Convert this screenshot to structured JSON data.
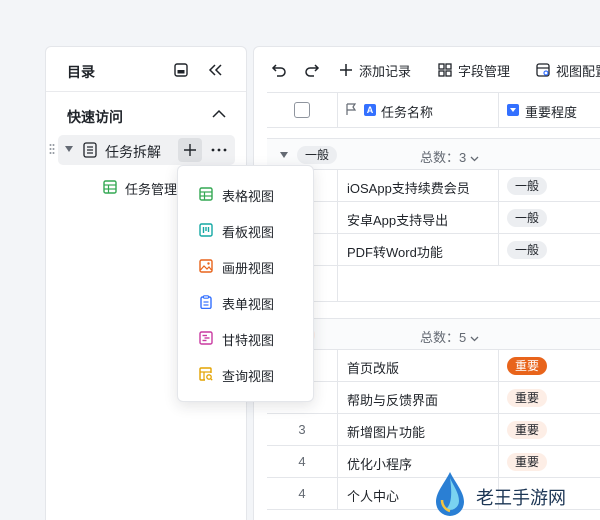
{
  "sidebar": {
    "title": "目录",
    "quick_access": "快速访问",
    "tree_item": "任务拆解",
    "sub_item": "任务管理"
  },
  "toolbar": {
    "add_record": "添加记录",
    "field_manage": "字段管理",
    "view_config": "视图配置"
  },
  "table": {
    "headers": {
      "task_name": "任务名称",
      "importance": "重要程度"
    },
    "groups": [
      {
        "tag": "一般",
        "count": "总数：3",
        "rows": [
          {
            "num": "",
            "name": "iOSApp支持续费会员",
            "level": "一般"
          },
          {
            "num": "",
            "name": "安卓App支持导出",
            "level": "一般"
          },
          {
            "num": "",
            "name": "PDF转Word功能",
            "level": "一般"
          }
        ]
      },
      {
        "tag": "重要",
        "count": "总数：5",
        "rows": [
          {
            "num": "",
            "name": "首页改版",
            "level": "重要"
          },
          {
            "num": "2",
            "name": "帮助与反馈界面",
            "level": "重要"
          },
          {
            "num": "3",
            "name": "新增图片功能",
            "level": "重要"
          },
          {
            "num": "4",
            "name": "优化小程序",
            "level": "重要"
          },
          {
            "num": "4",
            "name": "个人中心",
            "level": ""
          }
        ]
      }
    ]
  },
  "dropdown": {
    "items": [
      {
        "label": "表格视图",
        "icon": "grid-view-icon",
        "color": "#34a853"
      },
      {
        "label": "看板视图",
        "icon": "kanban-view-icon",
        "color": "#14a8a4"
      },
      {
        "label": "画册视图",
        "icon": "gallery-view-icon",
        "color": "#e8641b"
      },
      {
        "label": "表单视图",
        "icon": "form-view-icon",
        "color": "#3370ff"
      },
      {
        "label": "甘特视图",
        "icon": "gantt-view-icon",
        "color": "#c93aa1"
      },
      {
        "label": "查询视图",
        "icon": "query-view-icon",
        "color": "#e3a300"
      }
    ]
  },
  "watermark": {
    "text": "老王手游网"
  }
}
